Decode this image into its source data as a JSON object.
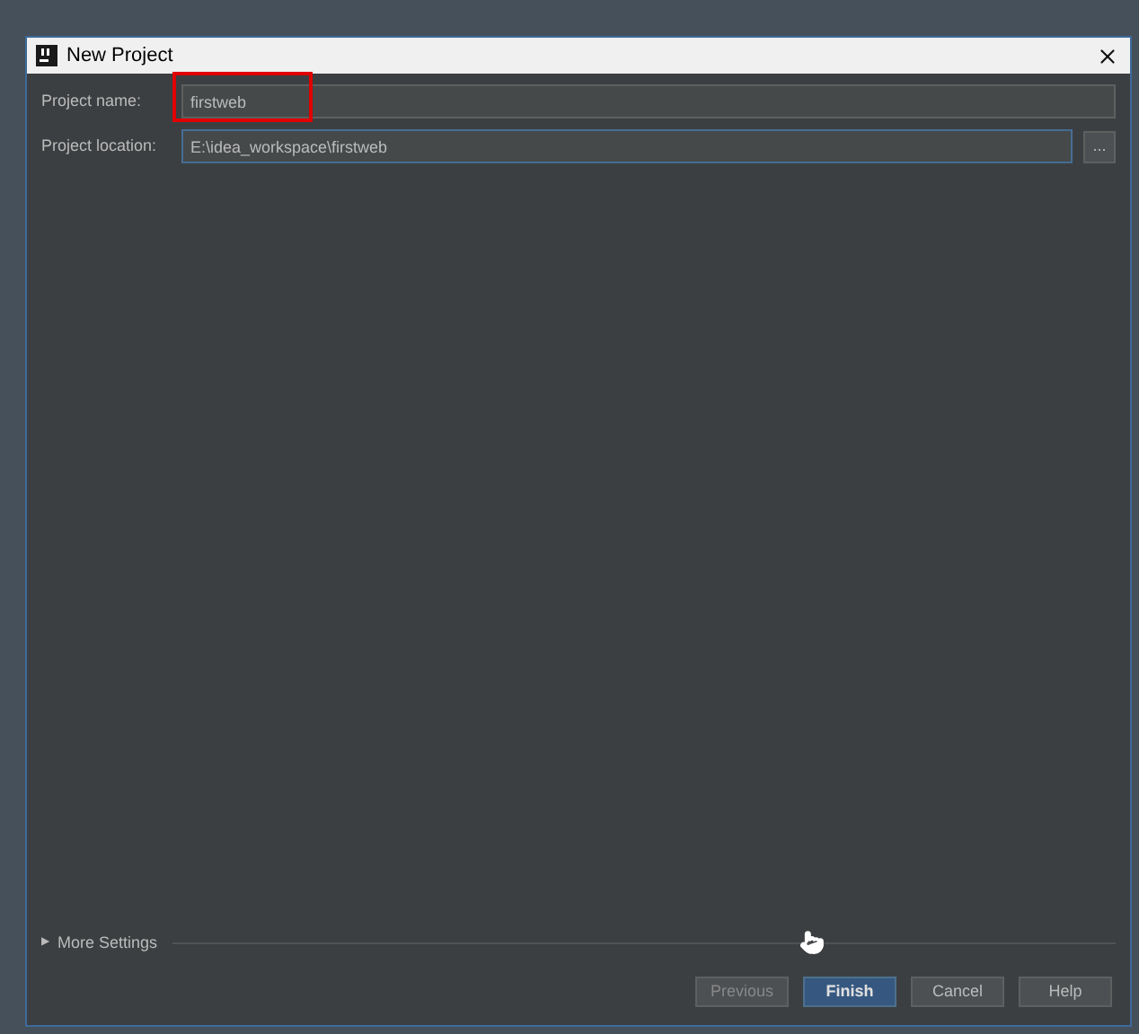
{
  "window": {
    "title": "New Project"
  },
  "fields": [
    {
      "label": "Project name:",
      "value": "firstweb",
      "focused": false,
      "highlighted": true
    },
    {
      "label": "Project location:",
      "value": "E:\\idea_workspace\\firstweb",
      "focused": true,
      "highlighted": false,
      "browse_label": "..."
    }
  ],
  "more_settings": {
    "toggle": "▶",
    "label": "More Settings",
    "expanded": false
  },
  "buttons": [
    {
      "label": "Previous",
      "disabled": true,
      "default": false
    },
    {
      "label": "Finish",
      "disabled": false,
      "default": true
    },
    {
      "label": "Cancel",
      "disabled": false,
      "default": false
    },
    {
      "label": "Help",
      "disabled": false,
      "default": false
    }
  ]
}
